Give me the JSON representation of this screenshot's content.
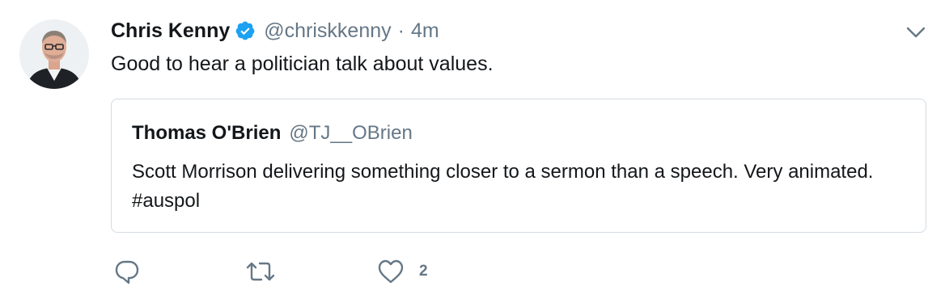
{
  "tweet": {
    "author_name": "Chris Kenny",
    "author_handle": "@chriskkenny",
    "separator": "·",
    "time": "4m",
    "text": "Good to hear a politician talk about values."
  },
  "quoted": {
    "author_name": "Thomas O'Brien",
    "author_handle": "@TJ__OBrien",
    "text": "Scott Morrison delivering something closer to a sermon than a speech. Very animated. #auspol"
  },
  "actions": {
    "reply_icon": "reply-icon",
    "retweet_icon": "retweet-icon",
    "like_icon": "heart-icon",
    "like_count": "2"
  },
  "colors": {
    "text": "#14171a",
    "secondary": "#657786",
    "verified": "#1da1f2",
    "border": "#d3dbe2"
  }
}
